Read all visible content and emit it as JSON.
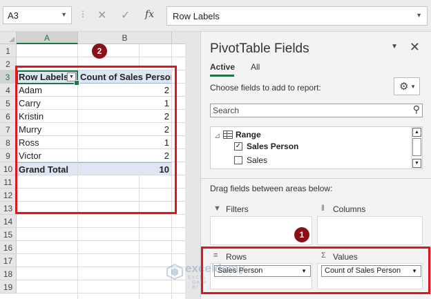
{
  "formula_bar": {
    "name_box": "A3",
    "cancel_icon": "✕",
    "enter_icon": "✓",
    "fx_label": "fx",
    "formula_value": "Row Labels"
  },
  "sheet": {
    "columns": [
      "A",
      "B"
    ],
    "rows": [
      "1",
      "2",
      "3",
      "4",
      "5",
      "6",
      "7",
      "8",
      "9",
      "10",
      "11",
      "12",
      "13",
      "14",
      "15",
      "16",
      "17",
      "18",
      "19"
    ],
    "pivot": {
      "header_row_labels": "Row Labels",
      "header_count": "Count of Sales Person",
      "items": [
        {
          "label": "Adam",
          "count": "2"
        },
        {
          "label": "Carry",
          "count": "1"
        },
        {
          "label": "Kristin",
          "count": "2"
        },
        {
          "label": "Murry",
          "count": "2"
        },
        {
          "label": "Ross",
          "count": "1"
        },
        {
          "label": "Victor",
          "count": "2"
        }
      ],
      "grand_total_label": "Grand Total",
      "grand_total_value": "10"
    }
  },
  "badges": {
    "one": "1",
    "two": "2"
  },
  "pivot_pane": {
    "title": "PivotTable Fields",
    "close_icon": "✕",
    "tabs": {
      "active": "Active",
      "all": "All"
    },
    "choose_label": "Choose fields to add to report:",
    "gear_icon": "⚙",
    "search_placeholder": "Search",
    "search_icon": "⚲",
    "field_list": {
      "group": "Range",
      "fields": [
        {
          "label": "Sales Person",
          "checked": true
        },
        {
          "label": "Sales",
          "checked": false
        }
      ]
    },
    "drag_label": "Drag fields between areas below:",
    "areas": {
      "filters": "Filters",
      "columns": "Columns",
      "rows": "Rows",
      "values": "Values",
      "rows_field": "Sales Person",
      "values_field": "Count of Sales Person"
    }
  },
  "watermark": {
    "name": "exceldemy",
    "sub": "EXCEL · DATA · BI"
  },
  "colors": {
    "excel_green": "#217346",
    "highlight_red": "#e0151e",
    "badge_red": "#8b0f17",
    "pivot_header_blue": "#dde6f3"
  }
}
